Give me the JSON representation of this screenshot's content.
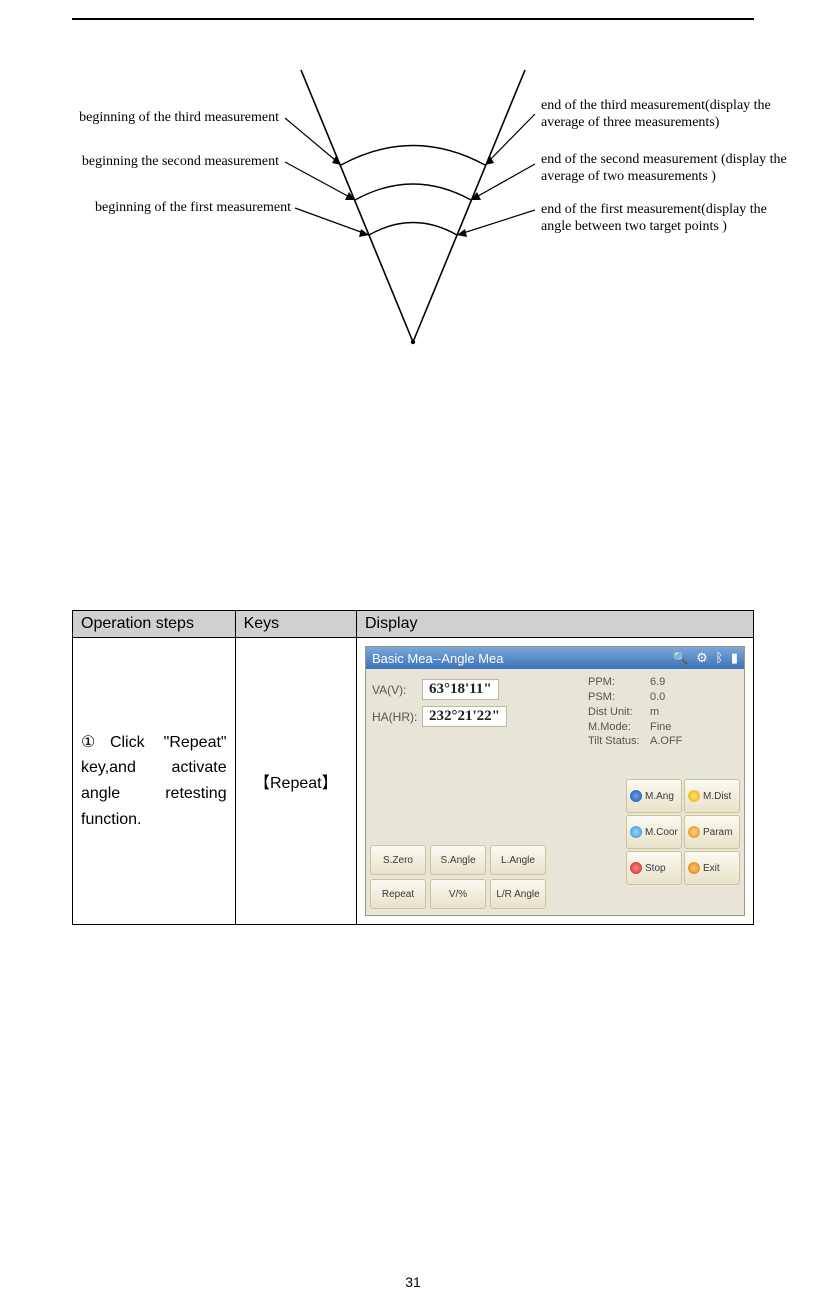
{
  "page_number": "31",
  "figure": {
    "left": {
      "third": "beginning  of the third measurement",
      "second": "beginning the second measurement",
      "first": "beginning of the first measurement"
    },
    "right": {
      "third": "end of the third measurement(display the average of three measurements)",
      "second": "end of the second measurement (display the average of two measurements )",
      "first": "end of the first measurement(display the angle between two target points )"
    }
  },
  "table": {
    "headers": {
      "op": "Operation steps",
      "keys": "Keys",
      "display": "Display"
    },
    "row1": {
      "op": "①Click \"Repeat\" key,and activate angle retesting function.",
      "keys": "【Repeat】"
    }
  },
  "device": {
    "title": "Basic Mea--Angle Mea",
    "va_label": "VA(V):",
    "ha_label": "HA(HR):",
    "va_value": "63°18'11\"",
    "ha_value": "232°21'22\"",
    "props": {
      "ppm_l": "PPM:",
      "ppm_v": "6.9",
      "psm_l": "PSM:",
      "psm_v": "0.0",
      "du_l": "Dist Unit:",
      "du_v": "m",
      "mm_l": "M.Mode:",
      "mm_v": "Fine",
      "ts_l": "Tilt Status:",
      "ts_v": "A.OFF"
    },
    "side": {
      "mang": "M.Ang",
      "mdist": "M.Dist",
      "mcoor": "M.Coor",
      "param": "Param",
      "stop": "Stop",
      "exit": "Exit"
    },
    "bottom": {
      "szero": "S.Zero",
      "sangle": "S.Angle",
      "langle": "L.Angle",
      "repeat": "Repeat",
      "vpct": "V/%",
      "lrangle": "L/R Angle"
    }
  }
}
